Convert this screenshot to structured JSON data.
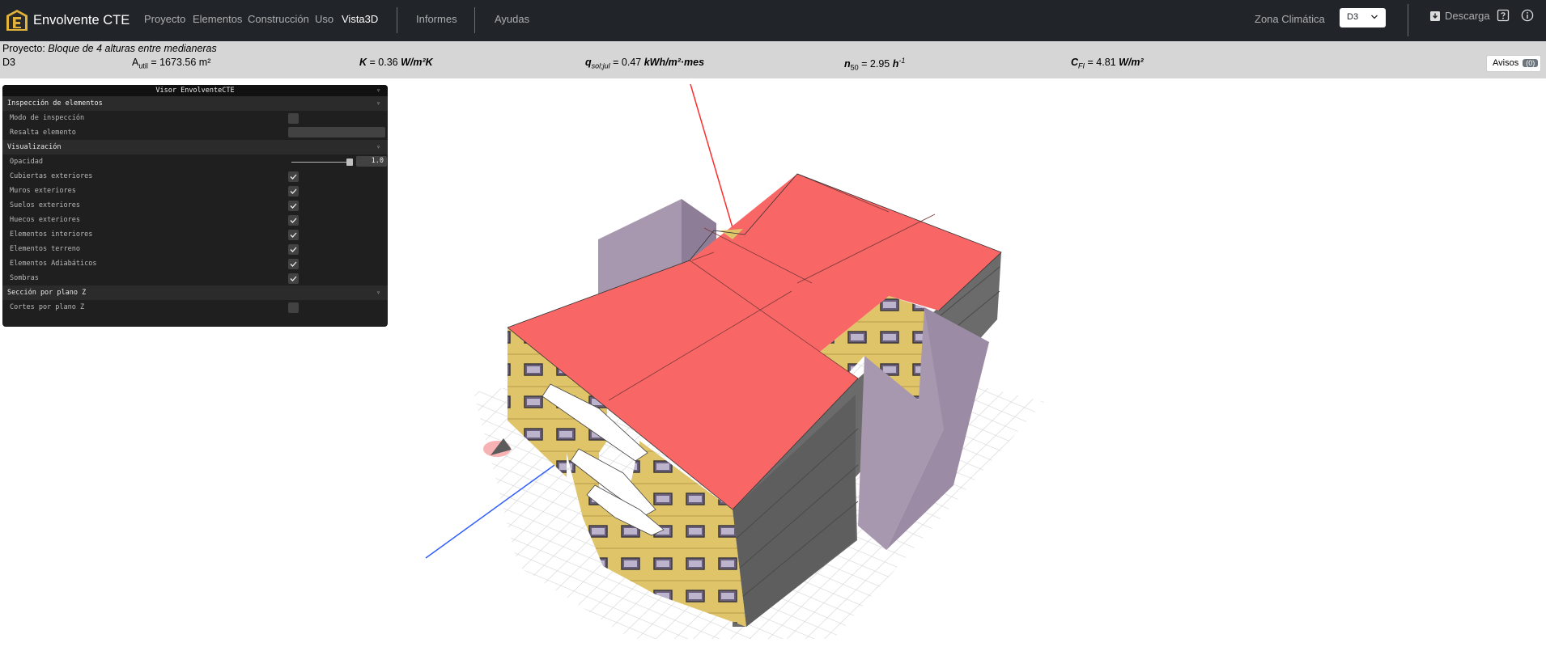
{
  "app": {
    "name": "Envolvente CTE"
  },
  "nav": {
    "items": [
      {
        "label": "Proyecto"
      },
      {
        "label": "Elementos"
      },
      {
        "label": "Construcción"
      },
      {
        "label": "Uso"
      },
      {
        "label": "Vista3D"
      }
    ],
    "informes": "Informes",
    "ayudas": "Ayudas",
    "zona_label": "Zona Climática",
    "zona_value": "D3",
    "descarga": "Descarga"
  },
  "project": {
    "label": "Proyecto:",
    "name": "Bloque de 4 alturas entre medianeras",
    "zone": "D3",
    "indicators": {
      "autil": {
        "symbol": "A",
        "sub": "util",
        "value": "1673.56",
        "unit": "m²"
      },
      "k": {
        "symbol": "K",
        "value": "0.36",
        "unit": "W/m²K"
      },
      "qsol": {
        "symbol": "q",
        "sub": "sol;jul",
        "value": "0.47",
        "unit": "kWh/m²·mes"
      },
      "n50": {
        "symbol": "n",
        "sub": "50",
        "value": "2.95",
        "unit": "h",
        "unit_sup": "-1"
      },
      "cfi": {
        "symbol": "C",
        "sub": "FI",
        "value": "4.81",
        "unit": "W/m²"
      }
    },
    "avisos_label": "Avisos",
    "avisos_count": "(0)"
  },
  "gui": {
    "title": "Visor EnvolventeCTE",
    "folders": {
      "inspeccion": {
        "title": "Inspección de elementos",
        "modo": "Modo de inspección",
        "resalta": "Resalta elemento"
      },
      "visualizacion": {
        "title": "Visualización",
        "opacidad": "Opacidad",
        "opacidad_value": "1.0",
        "opacidad_fraction": 1.0,
        "items": [
          {
            "label": "Cubiertas exteriores",
            "checked": true
          },
          {
            "label": "Muros exteriores",
            "checked": true
          },
          {
            "label": "Suelos exteriores",
            "checked": true
          },
          {
            "label": "Huecos exteriores",
            "checked": true
          },
          {
            "label": "Elementos interiores",
            "checked": true
          },
          {
            "label": "Elementos terreno",
            "checked": true
          },
          {
            "label": "Elementos Adiabáticos",
            "checked": true
          },
          {
            "label": "Sombras",
            "checked": true
          }
        ]
      },
      "seccion": {
        "title": "Sección por plano Z",
        "cortes": "Cortes por plano Z"
      }
    }
  },
  "colors": {
    "navbar": "#212529",
    "projbar": "#d6d6d6",
    "roof": "#f96666",
    "adiabatic": "#9e8fa6",
    "facade": "#e0c46a",
    "dark_wall": "#6a6a6a"
  },
  "icons": [
    "envolvente-logo-icon",
    "chevron-down-icon",
    "download-icon",
    "help-icon",
    "info-icon",
    "checkmark-icon"
  ]
}
